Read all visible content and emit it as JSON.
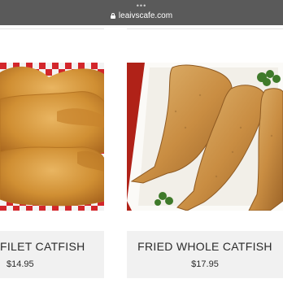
{
  "browser": {
    "menu_dots": "•••",
    "url": "leaivscafe.com"
  },
  "menu_items": [
    {
      "name": "FILET CATFISH",
      "price": "$14.95"
    },
    {
      "name": "FRIED WHOLE CATFISH",
      "price": "$17.95"
    }
  ],
  "colors": {
    "browser_bar": "#5a5a5a",
    "card_footer": "#f1f1f1",
    "fried_fish": "#d39a3e",
    "checkered_paper": "#d3262b"
  }
}
